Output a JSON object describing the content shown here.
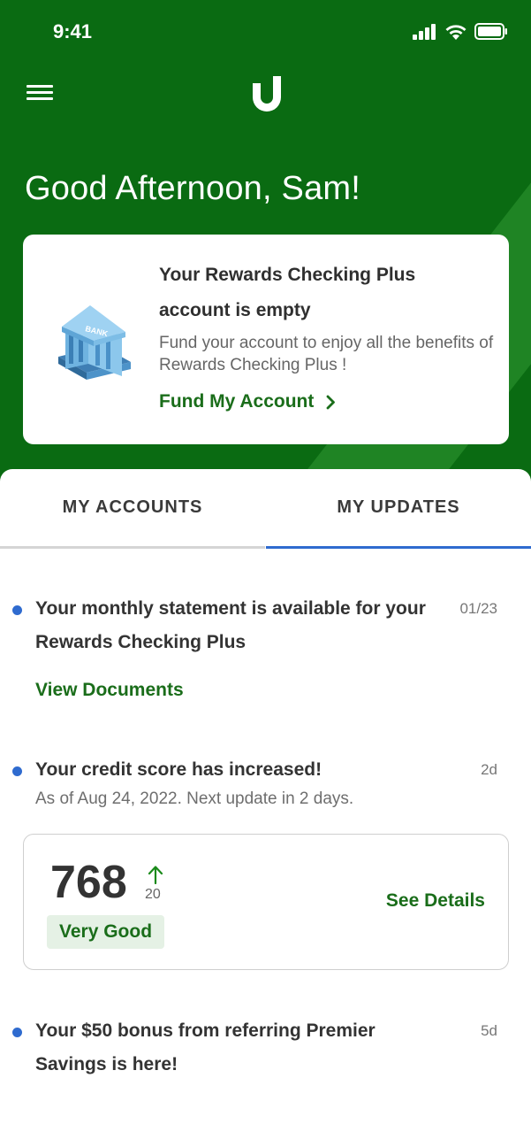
{
  "status": {
    "time": "9:41"
  },
  "header": {
    "greeting": "Good Afternoon, Sam!"
  },
  "fund_card": {
    "title": "Your Rewards Checking Plus account is empty",
    "description": "Fund your account to enjoy all the benefits of Rewards Checking Plus !",
    "link_label": "Fund My Account",
    "bank_sign": "BANK"
  },
  "tabs": [
    {
      "label": "MY ACCOUNTS",
      "selected": false
    },
    {
      "label": "MY UPDATES",
      "selected": true
    }
  ],
  "updates": [
    {
      "title": "Your monthly statement is available for your Rewards Checking Plus",
      "date": "01/23",
      "link": "View Documents"
    },
    {
      "title": "Your credit score has increased!",
      "date": "2d",
      "subtitle": "As of Aug 24, 2022. Next update in 2 days."
    },
    {
      "title": "Your $50 bonus from referring Premier Savings is here!",
      "date": "5d"
    }
  ],
  "credit_score": {
    "score": "768",
    "change": "20",
    "rating": "Very Good",
    "details_label": "See Details"
  },
  "colors": {
    "brand_green": "#0a6b12",
    "link_green": "#1a6d1a",
    "accent_blue": "#2f6bcf"
  },
  "icons": [
    "menu-icon",
    "brand-logo-icon",
    "bank-icon",
    "chevron-right-icon",
    "arrow-up-icon",
    "signal-icon",
    "wifi-icon",
    "battery-icon"
  ]
}
